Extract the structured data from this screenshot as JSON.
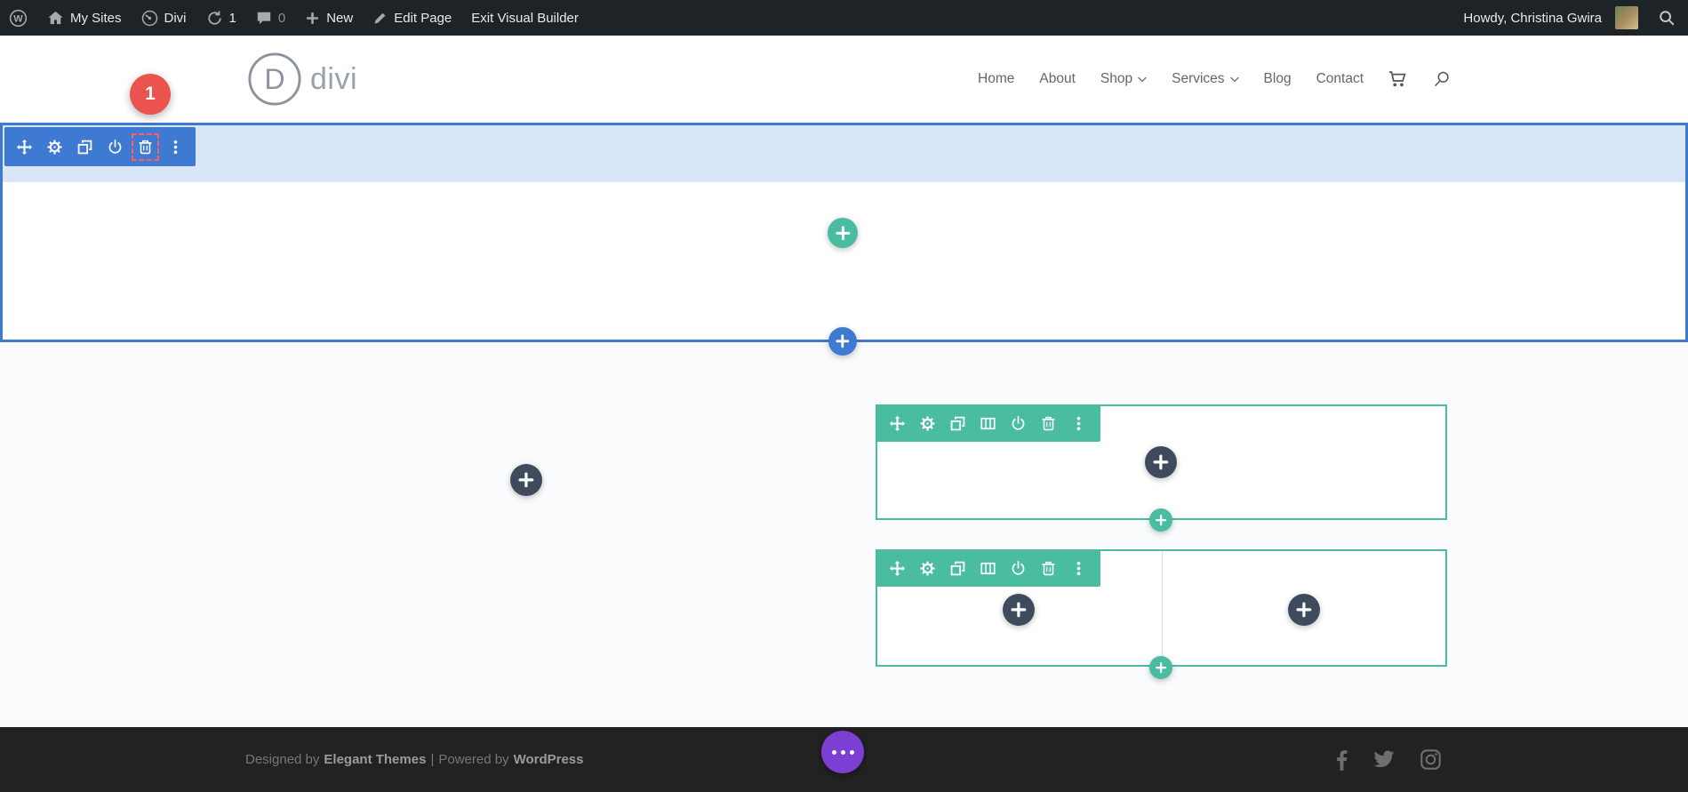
{
  "admin_bar": {
    "my_sites": "My Sites",
    "divi": "Divi",
    "updates_count": "1",
    "comments_count": "0",
    "new_label": "New",
    "edit_page_label": "Edit Page",
    "exit_label": "Exit Visual Builder",
    "howdy": "Howdy, Christina Gwira"
  },
  "header": {
    "logo_letter": "D",
    "logo_text": "divi",
    "nav": [
      {
        "label": "Home",
        "dropdown": false
      },
      {
        "label": "About",
        "dropdown": false
      },
      {
        "label": "Shop",
        "dropdown": true
      },
      {
        "label": "Services",
        "dropdown": true
      },
      {
        "label": "Blog",
        "dropdown": false
      },
      {
        "label": "Contact",
        "dropdown": false
      }
    ],
    "icons": [
      "cart-icon",
      "search-icon"
    ]
  },
  "annotation": {
    "step_number": "1"
  },
  "builder": {
    "section_toolbar": {
      "icons": [
        "move",
        "settings",
        "duplicate",
        "save",
        "trash",
        "options"
      ],
      "highlighted_icon": "trash"
    },
    "row1_toolbar": {
      "icons": [
        "move",
        "settings",
        "duplicate",
        "columns",
        "save",
        "trash",
        "options"
      ]
    },
    "row2_toolbar": {
      "icons": [
        "move",
        "settings",
        "duplicate",
        "columns",
        "save",
        "trash",
        "options"
      ]
    },
    "add_button_icon": "plus-icon"
  },
  "footer": {
    "designed_by": "Designed by",
    "elegant_themes": "Elegant Themes",
    "separator": "|",
    "powered_by": "Powered by",
    "wordpress": "WordPress",
    "social_icons": [
      "facebook-icon",
      "twitter-icon",
      "instagram-icon"
    ]
  },
  "colors": {
    "builder_blue": "#3e7ad1",
    "builder_teal": "#4abda1",
    "dark_slate": "#3e4b5c",
    "accent_purple": "#7b3fd4",
    "badge_red": "#eb534e",
    "admin_bar_bg": "#1d2327",
    "footer_bg": "#222222"
  }
}
